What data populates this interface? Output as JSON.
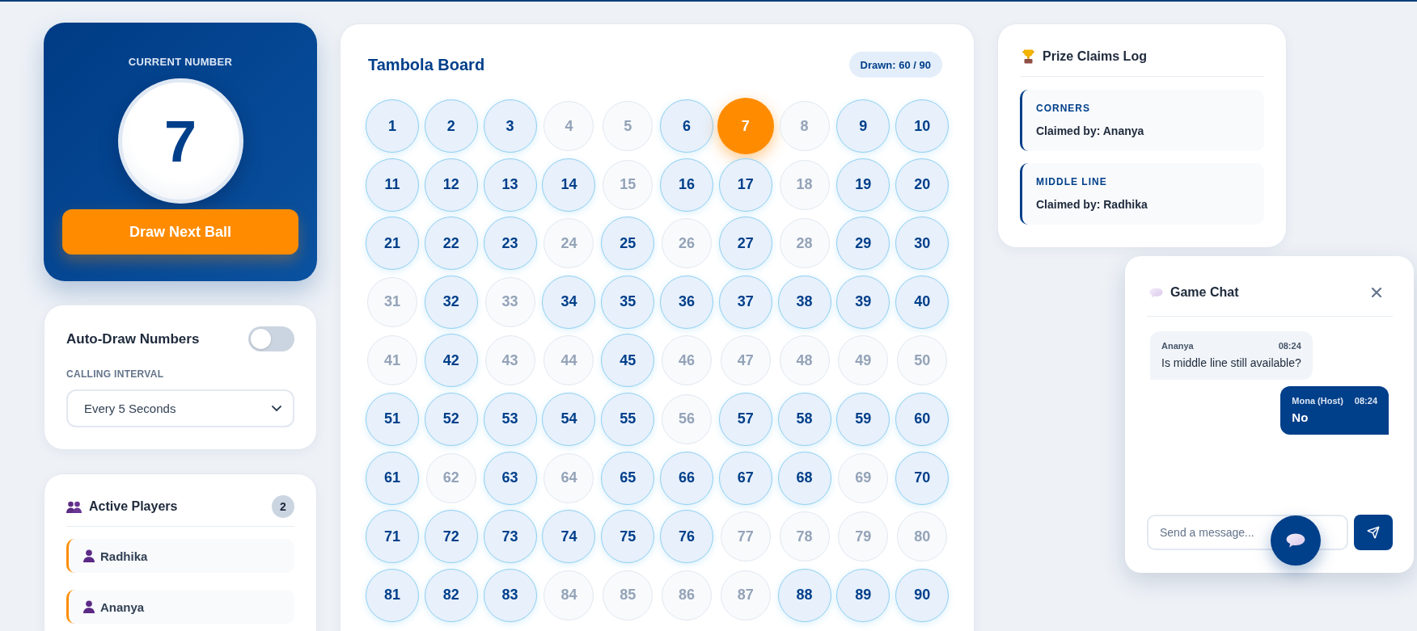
{
  "current_number": {
    "label": "CURRENT NUMBER",
    "value": "7",
    "draw_button": "Draw Next Ball"
  },
  "auto_draw": {
    "label": "Auto-Draw Numbers",
    "on": false
  },
  "calling_interval": {
    "label": "CALLING INTERVAL",
    "value": "Every 5 Seconds"
  },
  "active_players": {
    "title": "Active Players",
    "count": "2",
    "players": [
      {
        "name": "Radhika"
      },
      {
        "name": "Ananya"
      }
    ]
  },
  "board": {
    "title": "Tambola Board",
    "drawn_badge": "Drawn: 60 / 90",
    "numbers": [
      {
        "label": "1",
        "drawn": true,
        "current": false
      },
      {
        "label": "2",
        "drawn": true,
        "current": false
      },
      {
        "label": "3",
        "drawn": true,
        "current": false
      },
      {
        "label": "4",
        "drawn": false,
        "current": false
      },
      {
        "label": "5",
        "drawn": false,
        "current": false
      },
      {
        "label": "6",
        "drawn": true,
        "current": false
      },
      {
        "label": "7",
        "drawn": true,
        "current": true
      },
      {
        "label": "8",
        "drawn": false,
        "current": false
      },
      {
        "label": "9",
        "drawn": true,
        "current": false
      },
      {
        "label": "10",
        "drawn": true,
        "current": false
      },
      {
        "label": "11",
        "drawn": true,
        "current": false
      },
      {
        "label": "12",
        "drawn": true,
        "current": false
      },
      {
        "label": "13",
        "drawn": true,
        "current": false
      },
      {
        "label": "14",
        "drawn": true,
        "current": false
      },
      {
        "label": "15",
        "drawn": false,
        "current": false
      },
      {
        "label": "16",
        "drawn": true,
        "current": false
      },
      {
        "label": "17",
        "drawn": true,
        "current": false
      },
      {
        "label": "18",
        "drawn": false,
        "current": false
      },
      {
        "label": "19",
        "drawn": true,
        "current": false
      },
      {
        "label": "20",
        "drawn": true,
        "current": false
      },
      {
        "label": "21",
        "drawn": true,
        "current": false
      },
      {
        "label": "22",
        "drawn": true,
        "current": false
      },
      {
        "label": "23",
        "drawn": true,
        "current": false
      },
      {
        "label": "24",
        "drawn": false,
        "current": false
      },
      {
        "label": "25",
        "drawn": true,
        "current": false
      },
      {
        "label": "26",
        "drawn": false,
        "current": false
      },
      {
        "label": "27",
        "drawn": true,
        "current": false
      },
      {
        "label": "28",
        "drawn": false,
        "current": false
      },
      {
        "label": "29",
        "drawn": true,
        "current": false
      },
      {
        "label": "30",
        "drawn": true,
        "current": false
      },
      {
        "label": "31",
        "drawn": false,
        "current": false
      },
      {
        "label": "32",
        "drawn": true,
        "current": false
      },
      {
        "label": "33",
        "drawn": false,
        "current": false
      },
      {
        "label": "34",
        "drawn": true,
        "current": false
      },
      {
        "label": "35",
        "drawn": true,
        "current": false
      },
      {
        "label": "36",
        "drawn": true,
        "current": false
      },
      {
        "label": "37",
        "drawn": true,
        "current": false
      },
      {
        "label": "38",
        "drawn": true,
        "current": false
      },
      {
        "label": "39",
        "drawn": true,
        "current": false
      },
      {
        "label": "40",
        "drawn": true,
        "current": false
      },
      {
        "label": "41",
        "drawn": false,
        "current": false
      },
      {
        "label": "42",
        "drawn": true,
        "current": false
      },
      {
        "label": "43",
        "drawn": false,
        "current": false
      },
      {
        "label": "44",
        "drawn": false,
        "current": false
      },
      {
        "label": "45",
        "drawn": true,
        "current": false
      },
      {
        "label": "46",
        "drawn": false,
        "current": false
      },
      {
        "label": "47",
        "drawn": false,
        "current": false
      },
      {
        "label": "48",
        "drawn": false,
        "current": false
      },
      {
        "label": "49",
        "drawn": false,
        "current": false
      },
      {
        "label": "50",
        "drawn": false,
        "current": false
      },
      {
        "label": "51",
        "drawn": true,
        "current": false
      },
      {
        "label": "52",
        "drawn": true,
        "current": false
      },
      {
        "label": "53",
        "drawn": true,
        "current": false
      },
      {
        "label": "54",
        "drawn": true,
        "current": false
      },
      {
        "label": "55",
        "drawn": true,
        "current": false
      },
      {
        "label": "56",
        "drawn": false,
        "current": false
      },
      {
        "label": "57",
        "drawn": true,
        "current": false
      },
      {
        "label": "58",
        "drawn": true,
        "current": false
      },
      {
        "label": "59",
        "drawn": true,
        "current": false
      },
      {
        "label": "60",
        "drawn": true,
        "current": false
      },
      {
        "label": "61",
        "drawn": true,
        "current": false
      },
      {
        "label": "62",
        "drawn": false,
        "current": false
      },
      {
        "label": "63",
        "drawn": true,
        "current": false
      },
      {
        "label": "64",
        "drawn": false,
        "current": false
      },
      {
        "label": "65",
        "drawn": true,
        "current": false
      },
      {
        "label": "66",
        "drawn": true,
        "current": false
      },
      {
        "label": "67",
        "drawn": true,
        "current": false
      },
      {
        "label": "68",
        "drawn": true,
        "current": false
      },
      {
        "label": "69",
        "drawn": false,
        "current": false
      },
      {
        "label": "70",
        "drawn": true,
        "current": false
      },
      {
        "label": "71",
        "drawn": true,
        "current": false
      },
      {
        "label": "72",
        "drawn": true,
        "current": false
      },
      {
        "label": "73",
        "drawn": true,
        "current": false
      },
      {
        "label": "74",
        "drawn": true,
        "current": false
      },
      {
        "label": "75",
        "drawn": true,
        "current": false
      },
      {
        "label": "76",
        "drawn": true,
        "current": false
      },
      {
        "label": "77",
        "drawn": false,
        "current": false
      },
      {
        "label": "78",
        "drawn": false,
        "current": false
      },
      {
        "label": "79",
        "drawn": false,
        "current": false
      },
      {
        "label": "80",
        "drawn": false,
        "current": false
      },
      {
        "label": "81",
        "drawn": true,
        "current": false
      },
      {
        "label": "82",
        "drawn": true,
        "current": false
      },
      {
        "label": "83",
        "drawn": true,
        "current": false
      },
      {
        "label": "84",
        "drawn": false,
        "current": false
      },
      {
        "label": "85",
        "drawn": false,
        "current": false
      },
      {
        "label": "86",
        "drawn": false,
        "current": false
      },
      {
        "label": "87",
        "drawn": false,
        "current": false
      },
      {
        "label": "88",
        "drawn": true,
        "current": false
      },
      {
        "label": "89",
        "drawn": true,
        "current": false
      },
      {
        "label": "90",
        "drawn": true,
        "current": false
      }
    ]
  },
  "prize_claims_log": {
    "title": "Prize Claims Log",
    "claims": [
      {
        "prize": "CORNERS",
        "claimed_by": "Claimed by: Ananya"
      },
      {
        "prize": "MIDDLE LINE",
        "claimed_by": "Claimed by: Radhika"
      }
    ]
  },
  "game_chat": {
    "title": "Game Chat",
    "messages": [
      {
        "kind": "incoming",
        "sender": "Ananya",
        "time": "08:24",
        "text": "Is middle line still available?"
      },
      {
        "kind": "outgoing",
        "sender": "Mona (Host)",
        "time": "08:24",
        "text": "No"
      }
    ],
    "input": {
      "placeholder": "Send a message..."
    }
  }
}
